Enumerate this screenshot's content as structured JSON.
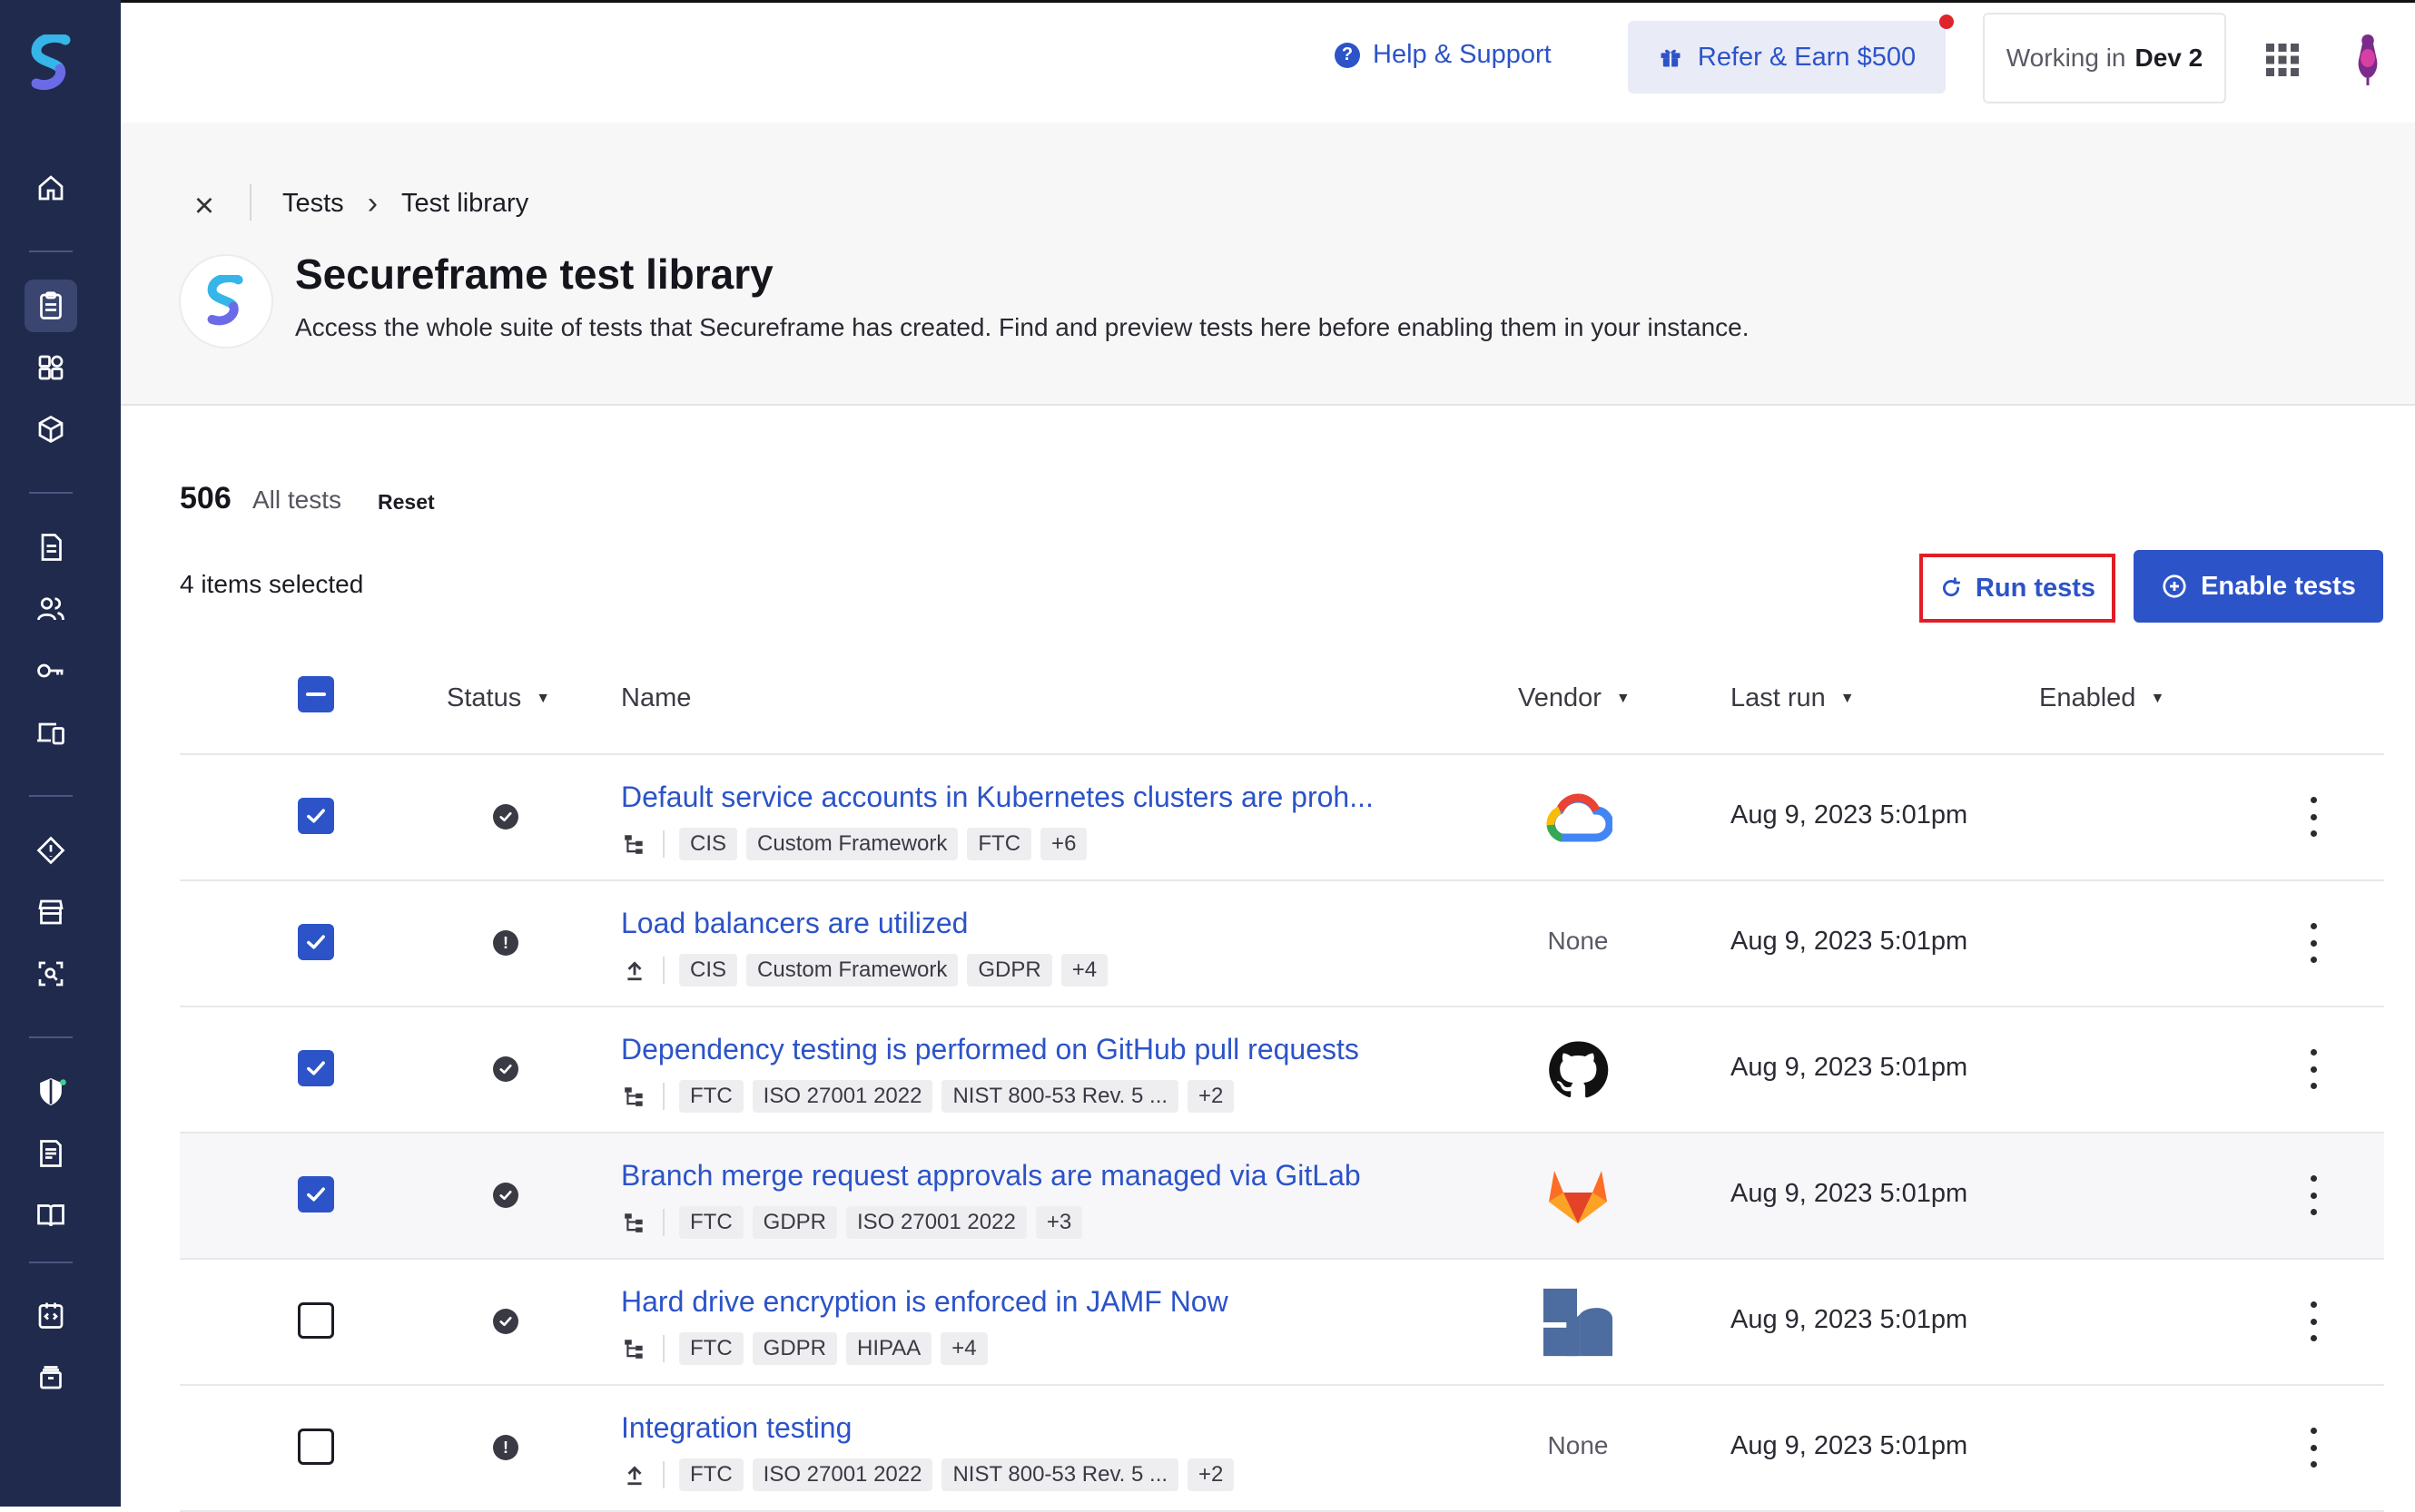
{
  "topbar": {
    "help_label": "Help & Support",
    "refer_label": "Refer & Earn $500",
    "working_prefix": "Working in",
    "workspace": "Dev 2"
  },
  "breadcrumb": [
    "Tests",
    "Test library"
  ],
  "header": {
    "title": "Secureframe test library",
    "description": "Access the whole suite of tests that Secureframe has created. Find and preview tests here before enabling them in your instance."
  },
  "summary": {
    "count": "506",
    "count_label": "All tests",
    "reset_label": "Reset",
    "selected_label": "4 items selected"
  },
  "actions": {
    "run_label": "Run tests",
    "enable_label": "Enable tests"
  },
  "columns": {
    "status": "Status",
    "name": "Name",
    "vendor": "Vendor",
    "last_run": "Last run",
    "enabled": "Enabled"
  },
  "rows": [
    {
      "checked": true,
      "status": "pass",
      "name": "Default service accounts in Kubernetes clusters are proh...",
      "meta_icon": "hierarchy-icon",
      "tags": [
        "CIS",
        "Custom Framework",
        "FTC",
        "+6"
      ],
      "vendor": "google-cloud",
      "vendor_text": "",
      "last_run": "Aug 9, 2023 5:01pm"
    },
    {
      "checked": true,
      "status": "warn",
      "name": "Load balancers are utilized",
      "meta_icon": "upload-icon",
      "tags": [
        "CIS",
        "Custom Framework",
        "GDPR",
        "+4"
      ],
      "vendor": "none",
      "vendor_text": "None",
      "last_run": "Aug 9, 2023 5:01pm"
    },
    {
      "checked": true,
      "status": "pass",
      "name": "Dependency testing is performed on GitHub pull requests",
      "meta_icon": "hierarchy-icon",
      "tags": [
        "FTC",
        "ISO 27001 2022",
        "NIST 800-53 Rev. 5 ...",
        "+2"
      ],
      "vendor": "github",
      "vendor_text": "",
      "last_run": "Aug 9, 2023 5:01pm"
    },
    {
      "checked": true,
      "status": "pass",
      "name": "Branch merge request approvals are managed via GitLab",
      "meta_icon": "hierarchy-icon",
      "tags": [
        "FTC",
        "GDPR",
        "ISO 27001 2022",
        "+3"
      ],
      "vendor": "gitlab",
      "vendor_text": "",
      "last_run": "Aug 9, 2023 5:01pm"
    },
    {
      "checked": false,
      "status": "pass",
      "name": "Hard drive encryption is enforced in JAMF Now",
      "meta_icon": "hierarchy-icon",
      "tags": [
        "FTC",
        "GDPR",
        "HIPAA",
        "+4"
      ],
      "vendor": "jamf",
      "vendor_text": "",
      "last_run": "Aug 9, 2023 5:01pm"
    },
    {
      "checked": false,
      "status": "warn",
      "name": "Integration testing",
      "meta_icon": "upload-icon",
      "tags": [
        "FTC",
        "ISO 27001 2022",
        "NIST 800-53 Rev. 5 ...",
        "+2"
      ],
      "vendor": "none",
      "vendor_text": "None",
      "last_run": "Aug 9, 2023 5:01pm"
    }
  ],
  "colors": {
    "sidebar": "#1f2a4d",
    "accent": "#2c53c8",
    "highlight_border": "#e01e25"
  }
}
